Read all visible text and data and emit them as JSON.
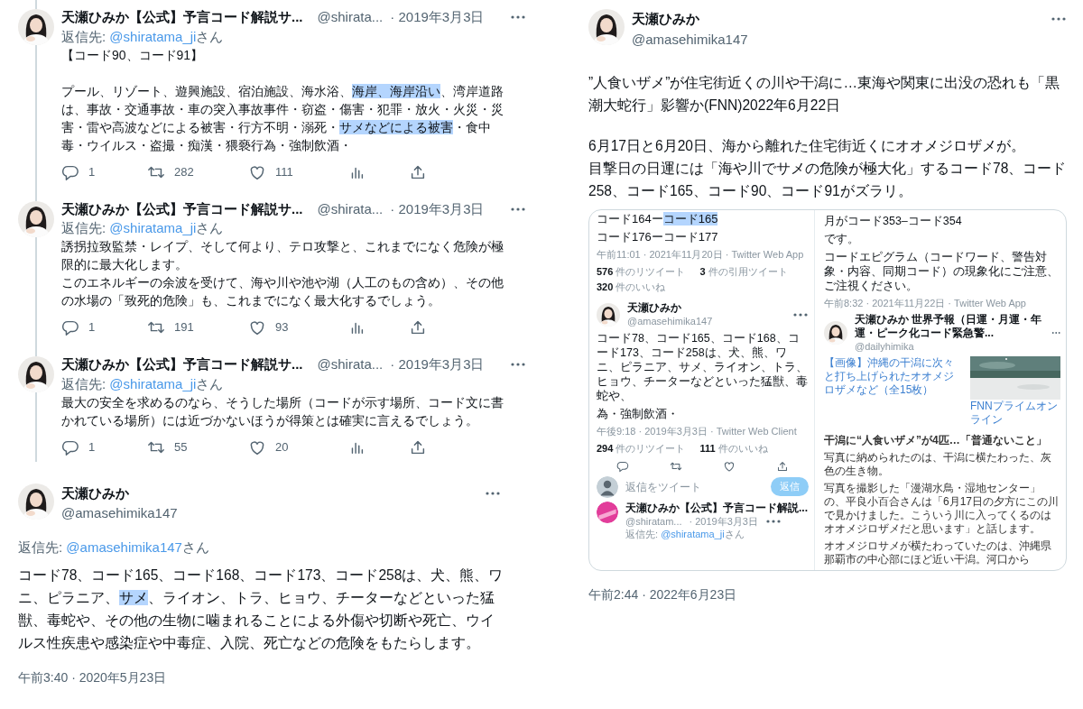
{
  "thread": [
    {
      "display_name": "天瀬ひみか【公式】予言コード解説サ...",
      "handle": "@shirata...",
      "date": "· 2019年3月3日",
      "reply_prefix": "返信先: ",
      "reply_to": "@shiratama_ji",
      "reply_suffix": "さん",
      "blocks": [
        [
          {
            "segments": [
              {
                "text": "【コード90、コード91】",
                "highlighted": false
              }
            ]
          }
        ],
        [
          {
            "segments": [
              {
                "text": "プール、リゾート、遊興施設、宿泊施設、海水浴、",
                "highlighted": false
              },
              {
                "text": "海岸、海岸沿い",
                "highlighted": true
              },
              {
                "text": "、湾岸道路は、事故・交通事故・車の突入事故事件・窃盗・傷害・犯罪・放火・火災・災害・雷や高波などによる被害・行方不明・溺死・",
                "highlighted": false
              },
              {
                "text": "サメなどによる被害",
                "highlighted": true
              },
              {
                "text": "・食中毒・ウイルス・盗撮・痴漢・猥褻行為・強制飲酒・",
                "highlighted": false
              }
            ]
          }
        ]
      ],
      "stats": {
        "replies": "1",
        "retweets": "282",
        "likes": "111"
      }
    },
    {
      "display_name": "天瀬ひみか【公式】予言コード解説サ...",
      "handle": "@shirata...",
      "date": "· 2019年3月3日",
      "reply_prefix": "返信先: ",
      "reply_to": "@shiratama_ji",
      "reply_suffix": "さん",
      "blocks": [
        [
          {
            "segments": [
              {
                "text": "誘拐拉致監禁・レイプ、そして何より、テロ攻撃と、これまでになく危険が極限的に最大化します。",
                "highlighted": false
              }
            ]
          },
          {
            "segments": [
              {
                "text": "このエネルギーの余波を受けて、海や川や池や湖（人工のもの含め）、その他の水場の「致死的危険」も、これまでになく最大化するでしょう。",
                "highlighted": false
              }
            ]
          }
        ]
      ],
      "stats": {
        "replies": "1",
        "retweets": "191",
        "likes": "93"
      }
    },
    {
      "display_name": "天瀬ひみか【公式】予言コード解説サ...",
      "handle": "@shirata...",
      "date": "· 2019年3月3日",
      "reply_prefix": "返信先: ",
      "reply_to": "@shiratama_ji",
      "reply_suffix": "さん",
      "blocks": [
        [
          {
            "segments": [
              {
                "text": "最大の安全を求めるのなら、そうした場所（コードが示す場所、コード文に書かれている場所）には近づかないほうが得策とは確実に言えるでしょう。",
                "highlighted": false
              }
            ]
          }
        ]
      ],
      "stats": {
        "replies": "1",
        "retweets": "55",
        "likes": "20"
      }
    }
  ],
  "main_tweet": {
    "display_name": "天瀬ひみか",
    "handle": "@amasehimika147",
    "reply_prefix": "返信先: ",
    "reply_to": "@amasehimika147",
    "reply_suffix": "さん",
    "blocks": [
      [
        {
          "segments": [
            {
              "text": "コード78、コード165、コード168、コード173、コード258は、犬、熊、ワニ、ピラニア、",
              "highlighted": false
            },
            {
              "text": "サメ",
              "highlighted": true
            },
            {
              "text": "、ライオン、トラ、ヒョウ、チーターなどといった猛獣、毒蛇や、その他の生物に噛まれることによる外傷や切断や死亡、ウイルス性疾患や感染症や中毒症、入院、死亡などの危険をもたらします。",
              "highlighted": false
            }
          ]
        }
      ]
    ],
    "timestamp": "午前3:40 · 2020年5月23日"
  },
  "right_tweet": {
    "display_name": "天瀬ひみか",
    "handle": "@amasehimika147",
    "blocks": [
      [
        {
          "segments": [
            {
              "text": "”人食いザメ”が住宅街近くの川や干潟に…東海や関東に出没の恐れも「黒潮大蛇行」影響か(FNN)2022年6月22日",
              "highlighted": false
            }
          ]
        }
      ],
      [
        {
          "segments": [
            {
              "text": "6月17日と6月20日、海から離れた住宅街近くにオオメジロザメが。",
              "highlighted": false
            }
          ]
        },
        {
          "segments": [
            {
              "text": "目撃日の日運には「海や川でサメの危険が極大化」するコード78、コード258、コード165、コード90、コード91がズラリ。",
              "highlighted": false
            }
          ]
        }
      ]
    ],
    "media": {
      "left": {
        "code_lines": [
          {
            "segments": [
              {
                "text": "コード164ー",
                "highlighted": false
              },
              {
                "text": "コード165",
                "highlighted": true
              }
            ]
          },
          {
            "segments": [
              {
                "text": "コード176ーコード177",
                "highlighted": false
              }
            ]
          }
        ],
        "meta": "午前11:01 · 2021年11月20日 · Twitter Web App",
        "stats": [
          "**576** 件のリツイート",
          "**3** 件の引用ツイート",
          "**320** 件のいいね"
        ],
        "inner_tweet": {
          "display_name": "天瀬ひみか",
          "handle": "@amasehimika147",
          "text": "コード78、コード165、コード168、コード173、コード258は、犬、熊、ワニ、ピラニア、サメ、ライオン、トラ、ヒョウ、チーターなどといった猛獣、毒蛇や、",
          "text_end": "為・強制飲酒・",
          "meta": "午後9:18 · 2019年3月3日 · Twitter Web Client",
          "stats": [
            "**294** 件のリツイート",
            "**111** 件のいいね"
          ]
        },
        "reply_box": {
          "placeholder": "返信をツイート",
          "button": "返信"
        },
        "next_tweet": {
          "display_name": "天瀬ひみか【公式】予言コード解説...",
          "handle": "@shiratam...",
          "date": "· 2019年3月3日",
          "reply_prefix": "返信先: ",
          "reply_to": "@shiratama_ji",
          "reply_suffix": "さん"
        }
      },
      "right": {
        "lines": [
          "月がコード353–コード354",
          "です。",
          "コードエピグラム（コードワード、警告対象・内容、同期コード）の現象化にご注意、ご注視ください。"
        ],
        "meta": "午前8:32 · 2021年11月22日 · Twitter Web App",
        "inner_header": {
          "display_name": "天瀬ひみか 世界予報（日運・月運・年運・ピーク化コード緊急警...",
          "handle": "@dailyhimika"
        },
        "link": {
          "title": "【画像】沖縄の干潟に次々と打ち上げられたオオメジロザメなど（全15枚）",
          "source": "FNNプライムオンライン"
        },
        "article": {
          "heading": "干潟に“人食いザメ”が4匹…「普通ないこと」",
          "paragraphs": [
            "写真に納められたのは、干潟に横たわった、灰色の生き物。",
            "写真を撮影した「漫湖水鳥・湿地センター」の、平良小百合さんは「6月17日の夕方にこの川で見かけました。こういう川に入ってくるのはオオメジロザメだと思います」と話します。",
            "オオメジロサメが横たわっていたのは、沖縄県那覇市の中心部にほど近い干潟。河口から"
          ]
        }
      }
    },
    "timestamp": "午前2:44 · 2022年6月23日"
  }
}
